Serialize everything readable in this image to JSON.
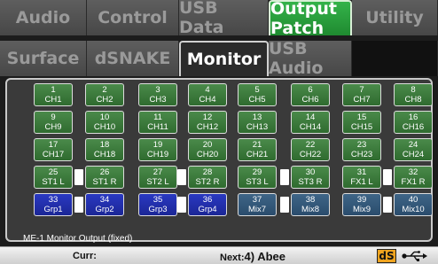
{
  "tabs": {
    "row1": [
      "Audio",
      "Control",
      "USB Data",
      "Output Patch",
      "Utility"
    ],
    "row2": [
      "Surface",
      "dSNAKE",
      "Monitor",
      "USB Audio"
    ]
  },
  "note": "ME-1 Monitor Output (fixed)",
  "status": {
    "curr_label": "Curr:",
    "next_label": "Next:",
    "next_value": "4) Abee",
    "ds_badge": "dS"
  },
  "buttons": [
    [
      {
        "n": "1",
        "l": "CH1",
        "c": "green"
      },
      {
        "n": "2",
        "l": "CH2",
        "c": "green"
      },
      {
        "n": "3",
        "l": "CH3",
        "c": "green"
      },
      {
        "n": "4",
        "l": "CH4",
        "c": "green"
      },
      {
        "n": "5",
        "l": "CH5",
        "c": "green"
      },
      {
        "n": "6",
        "l": "CH6",
        "c": "green"
      },
      {
        "n": "7",
        "l": "CH7",
        "c": "green"
      },
      {
        "n": "8",
        "l": "CH8",
        "c": "green"
      }
    ],
    [
      {
        "n": "9",
        "l": "CH9",
        "c": "green"
      },
      {
        "n": "10",
        "l": "CH10",
        "c": "green"
      },
      {
        "n": "11",
        "l": "CH11",
        "c": "green"
      },
      {
        "n": "12",
        "l": "CH12",
        "c": "green"
      },
      {
        "n": "13",
        "l": "CH13",
        "c": "green"
      },
      {
        "n": "14",
        "l": "CH14",
        "c": "green"
      },
      {
        "n": "15",
        "l": "CH15",
        "c": "green"
      },
      {
        "n": "16",
        "l": "CH16",
        "c": "green"
      }
    ],
    [
      {
        "n": "17",
        "l": "CH17",
        "c": "green"
      },
      {
        "n": "18",
        "l": "CH18",
        "c": "green"
      },
      {
        "n": "19",
        "l": "CH19",
        "c": "green"
      },
      {
        "n": "20",
        "l": "CH20",
        "c": "green"
      },
      {
        "n": "21",
        "l": "CH21",
        "c": "green"
      },
      {
        "n": "22",
        "l": "CH22",
        "c": "green"
      },
      {
        "n": "23",
        "l": "CH23",
        "c": "green"
      },
      {
        "n": "24",
        "l": "CH24",
        "c": "green"
      }
    ],
    [
      {
        "n": "25",
        "l": "ST1 L",
        "c": "green"
      },
      {
        "n": "26",
        "l": "ST1 R",
        "c": "green"
      },
      {
        "n": "27",
        "l": "ST2 L",
        "c": "green"
      },
      {
        "n": "28",
        "l": "ST2 R",
        "c": "green"
      },
      {
        "n": "29",
        "l": "ST3 L",
        "c": "green"
      },
      {
        "n": "30",
        "l": "ST3 R",
        "c": "green"
      },
      {
        "n": "31",
        "l": "FX1 L",
        "c": "green"
      },
      {
        "n": "32",
        "l": "FX1 R",
        "c": "green"
      }
    ],
    [
      {
        "n": "33",
        "l": "Grp1",
        "c": "blue"
      },
      {
        "n": "34",
        "l": "Grp2",
        "c": "blue"
      },
      {
        "n": "35",
        "l": "Grp3",
        "c": "blue"
      },
      {
        "n": "36",
        "l": "Grp4",
        "c": "blue"
      },
      {
        "n": "37",
        "l": "Mix7",
        "c": "slate"
      },
      {
        "n": "38",
        "l": "Mix8",
        "c": "slate"
      },
      {
        "n": "39",
        "l": "Mix9",
        "c": "slate"
      },
      {
        "n": "40",
        "l": "Mix10",
        "c": "slate"
      }
    ]
  ]
}
